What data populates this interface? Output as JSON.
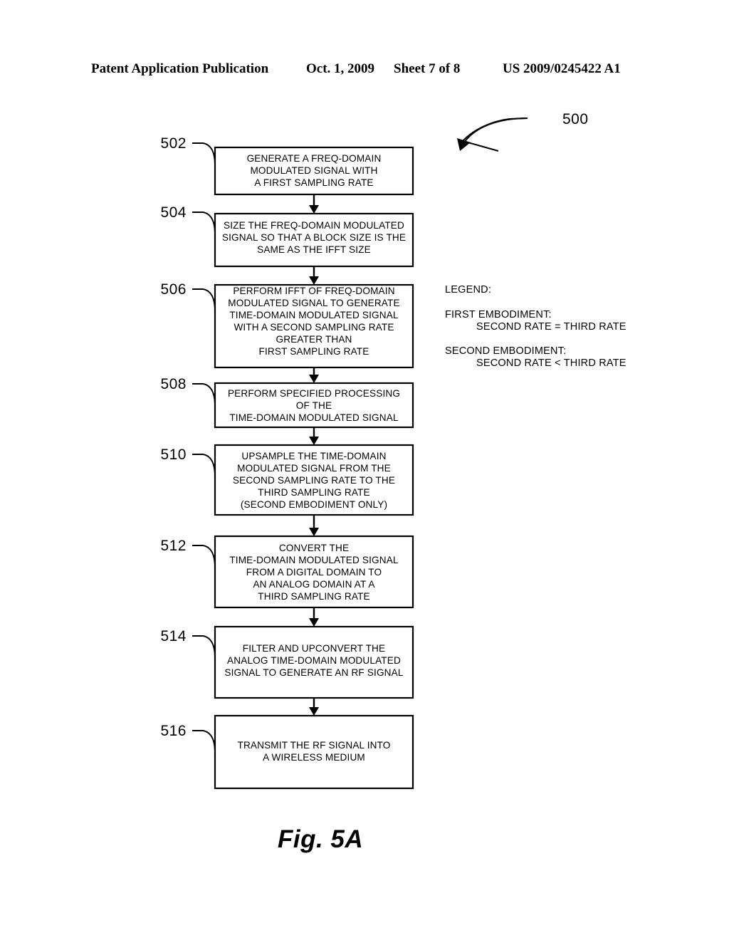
{
  "header": {
    "publication": "Patent Application Publication",
    "date": "Oct. 1, 2009",
    "sheet": "Sheet 7 of 8",
    "patent_number": "US 2009/0245422 A1"
  },
  "figure": {
    "caption": "Fig. 5A",
    "diagram_ref": "500"
  },
  "flowchart": {
    "boxes": [
      {
        "ref": "502",
        "lines": [
          "GENERATE A FREQ-DOMAIN",
          "MODULATED SIGNAL WITH",
          "A FIRST SAMPLING RATE"
        ]
      },
      {
        "ref": "504",
        "lines": [
          "SIZE THE FREQ-DOMAIN MODULATED",
          "SIGNAL SO THAT A BLOCK SIZE IS THE",
          "SAME AS THE IFFT SIZE"
        ]
      },
      {
        "ref": "506",
        "lines": [
          "PERFORM IFFT OF FREQ-DOMAIN",
          "MODULATED SIGNAL TO GENERATE",
          "TIME-DOMAIN MODULATED SIGNAL",
          "WITH A SECOND SAMPLING RATE",
          "GREATER THAN",
          "FIRST SAMPLING RATE"
        ]
      },
      {
        "ref": "508",
        "lines": [
          "PERFORM SPECIFIED PROCESSING",
          "OF THE",
          "TIME-DOMAIN MODULATED SIGNAL"
        ]
      },
      {
        "ref": "510",
        "lines": [
          "UPSAMPLE THE TIME-DOMAIN",
          "MODULATED SIGNAL FROM THE",
          "SECOND SAMPLING RATE TO THE",
          "THIRD SAMPLING RATE",
          "(SECOND EMBODIMENT ONLY)"
        ]
      },
      {
        "ref": "512",
        "lines": [
          "CONVERT THE",
          "TIME-DOMAIN MODULATED SIGNAL",
          "FROM A DIGITAL DOMAIN TO",
          "AN ANALOG DOMAIN AT A",
          "THIRD SAMPLING RATE"
        ]
      },
      {
        "ref": "514",
        "lines": [
          "FILTER AND UPCONVERT THE",
          "ANALOG TIME-DOMAIN MODULATED",
          "SIGNAL TO GENERATE AN RF SIGNAL"
        ]
      },
      {
        "ref": "516",
        "lines": [
          "TRANSMIT THE RF SIGNAL INTO",
          "A WIRELESS MEDIUM"
        ]
      }
    ]
  },
  "legend": {
    "title": "LEGEND:",
    "entries": [
      {
        "heading": "FIRST EMBODIMENT:",
        "detail": "SECOND RATE = THIRD RATE"
      },
      {
        "heading": "SECOND EMBODIMENT:",
        "detail": "SECOND RATE < THIRD RATE"
      }
    ]
  },
  "colors": {
    "ink": "#000000",
    "paper": "#ffffff"
  }
}
